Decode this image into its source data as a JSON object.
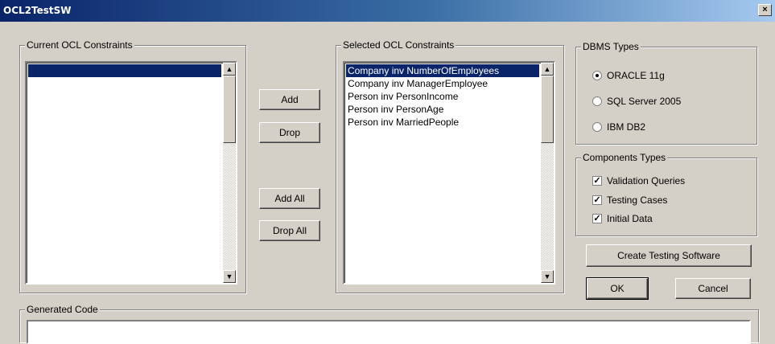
{
  "window": {
    "title": "OCL2TestSW",
    "close_glyph": "×"
  },
  "current": {
    "label": "Current OCL Constraints",
    "items": [
      ""
    ]
  },
  "selected": {
    "label": "Selected OCL Constraints",
    "items": [
      "Company inv NumberOfEmployees",
      "Company inv ManagerEmployee",
      "Person inv PersonIncome",
      "Person inv PersonAge",
      "Person inv MarriedPeople"
    ]
  },
  "buttons": {
    "add": "Add",
    "drop": "Drop",
    "add_all": "Add All",
    "drop_all": "Drop All",
    "create": "Create Testing Software",
    "ok": "OK",
    "cancel": "Cancel"
  },
  "dbms": {
    "label": "DBMS Types",
    "options": [
      {
        "label": "ORACLE 11g",
        "checked": true
      },
      {
        "label": "SQL Server 2005",
        "checked": false
      },
      {
        "label": "IBM DB2",
        "checked": false
      }
    ]
  },
  "components": {
    "label": "Components Types",
    "options": [
      {
        "label": "Validation Queries",
        "checked": true
      },
      {
        "label": "Testing Cases",
        "checked": true
      },
      {
        "label": "Initial Data",
        "checked": true
      }
    ]
  },
  "generated": {
    "label": "Generated Code",
    "value": ""
  },
  "icons": {
    "scroll_up": "scroll-up-arrow-icon",
    "scroll_down": "scroll-down-arrow-icon"
  },
  "colors": {
    "selection": "#0a246a",
    "face": "#d4d0c8"
  }
}
